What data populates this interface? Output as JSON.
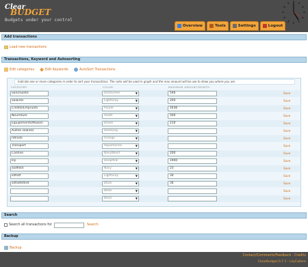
{
  "header": {
    "logo_line1": "Clear",
    "logo_line2": "BUDGET",
    "tagline": "Budgets under your control"
  },
  "nav": [
    {
      "label": "Overview",
      "icon": "overview-icon",
      "color": "#3b7dd8"
    },
    {
      "label": "Tools",
      "icon": "tools-icon",
      "color": "#b05a1a"
    },
    {
      "label": "Settings",
      "icon": "settings-icon",
      "color": "#6b6b6b"
    },
    {
      "label": "Logout",
      "icon": "logout-icon",
      "color": "#c0392b"
    }
  ],
  "sections": {
    "add_transactions": "Add transactions",
    "load_new": "Load new transactions",
    "keyword_section": "Transactions, Keyword and Autosorting",
    "edit_categories": "Edit categories",
    "edit_keywords": "Edit Keywords",
    "autosort": "AutoSort Transactions",
    "search": "Search",
    "search_label": "Search all transactions for",
    "search_button": "Search",
    "backup": "Backup",
    "backup_link": "Backup"
  },
  "categories": {
    "note": "Indicate one or more categories in order to sort your transactions. The color will be used in graph and the max amount will be use to show you where you are.",
    "col_category": "CATEGORY",
    "col_color": "COLOR",
    "col_max": "MAXIMUM AMOUNT/MONTH",
    "save_label": "Save",
    "rows": [
      {
        "category": "Sans/Santé",
        "color": "DarkGreen",
        "max": "546"
      },
      {
        "category": "Salaires",
        "color": "LightGray",
        "max": "200"
      },
      {
        "category": "Credits/Emprunts",
        "color": "Purple",
        "max": "1636"
      },
      {
        "category": "Nourriture",
        "color": "Violet",
        "max": "500"
      },
      {
        "category": "Equipements/Maison",
        "color": "Brown",
        "max": "210"
      },
      {
        "category": "Autres salaires",
        "color": "DarkGray",
        "max": ""
      },
      {
        "category": "retraits",
        "color": "Orange",
        "max": ""
      },
      {
        "category": "Transport",
        "color": "Aquamarine",
        "max": ""
      },
      {
        "category": "Cantine",
        "color": "NavyWood",
        "max": "200"
      },
      {
        "category": "lily",
        "color": "DeepPink",
        "max": "1900"
      },
      {
        "category": "asdfdsd",
        "color": "Navy",
        "max": "23"
      },
      {
        "category": "sdfsdf",
        "color": "LightGray",
        "max": "34"
      },
      {
        "category": "sdfsdfettret",
        "color": "Black",
        "max": "34"
      },
      {
        "category": "",
        "color": "Black",
        "max": ""
      },
      {
        "category": "",
        "color": "Black",
        "max": ""
      }
    ]
  },
  "footer": {
    "links": "Contact/Comments/Feedback - Credits",
    "version": "ClearBudget 0.7.1 - LilyCollere"
  }
}
